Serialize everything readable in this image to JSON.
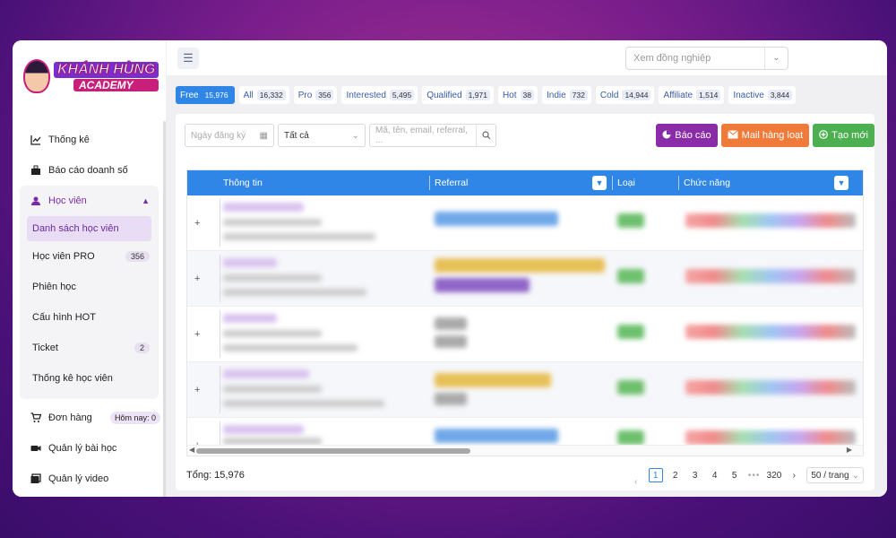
{
  "brand": {
    "line1": "KHÁNH HÙNG",
    "line2": "ACADEMY"
  },
  "sidebar": {
    "items": [
      {
        "label": "Thống kê",
        "icon": "chart-line-icon"
      },
      {
        "label": "Báo cáo doanh số",
        "icon": "sales-report-icon"
      }
    ],
    "group": {
      "label": "Học viên",
      "icon": "students-icon",
      "children": [
        {
          "label": "Danh sách học viên",
          "active": true
        },
        {
          "label": "Học viên PRO",
          "badge": "356"
        },
        {
          "label": "Phiên học"
        },
        {
          "label": "Cấu hình HOT"
        },
        {
          "label": "Ticket",
          "badge": "2"
        },
        {
          "label": "Thống kê học viên"
        }
      ]
    },
    "bottom": [
      {
        "label": "Đơn hàng",
        "icon": "cart-icon",
        "badge": "Hôm nay: 0"
      },
      {
        "label": "Quản lý bài học",
        "icon": "video-camera-icon"
      },
      {
        "label": "Quản lý video",
        "icon": "video-library-icon"
      }
    ]
  },
  "topbar": {
    "colleague_placeholder": "Xem đồng nghiệp"
  },
  "filters": [
    {
      "label": "Free",
      "count": "15,976",
      "active": true
    },
    {
      "label": "All",
      "count": "16,332"
    },
    {
      "label": "Pro",
      "count": "356"
    },
    {
      "label": "Interested",
      "count": "5,495"
    },
    {
      "label": "Qualified",
      "count": "1,971"
    },
    {
      "label": "Hot",
      "count": "38"
    },
    {
      "label": "Indie",
      "count": "732"
    },
    {
      "label": "Cold",
      "count": "14,944"
    },
    {
      "label": "Affiliate",
      "count": "1,514"
    },
    {
      "label": "Inactive",
      "count": "3,844"
    }
  ],
  "toolbar": {
    "date_placeholder": "Ngày đăng ký",
    "status_value": "Tất cả",
    "search_placeholder": "Mã, tên, email, referral, ...",
    "report_label": "Báo cáo",
    "mail_label": "Mail hàng loạt",
    "create_label": "Tạo mới"
  },
  "table": {
    "columns": [
      "Thông tin",
      "Referral",
      "Loại",
      "Chức năng"
    ],
    "row_count_visible": 5,
    "expand_symbol": "+"
  },
  "footer": {
    "total": "Tổng: 15,976",
    "pages": [
      "1",
      "2",
      "3",
      "4",
      "5",
      "•••",
      "320"
    ],
    "current_page": "1",
    "page_size": "50 / trang"
  },
  "colors": {
    "primary": "#2f86e6",
    "purple": "#8a2ca8",
    "orange": "#f07a3a",
    "green": "#4caf50"
  }
}
